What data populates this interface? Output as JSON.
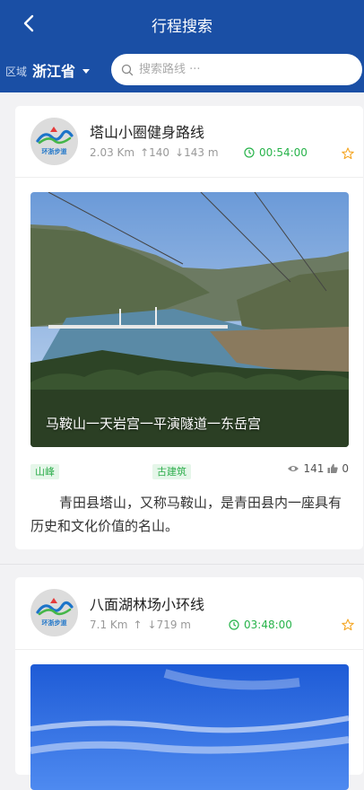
{
  "header": {
    "title": "行程搜索",
    "region_label": "区域",
    "region_value": "浙江省",
    "search_placeholder": "搜索路线 ···"
  },
  "colors": {
    "header_bg": "#1a4fa5",
    "time_green": "#27b34a",
    "tag_green": "#2eae4d",
    "star_orange": "#f5a623"
  },
  "routes": [
    {
      "name": "塔山小圈健身路线",
      "distance": "2.03 Km",
      "ascent": "↑140",
      "descent": "↓143 m",
      "duration": "00:54:00",
      "photo_caption": "马鞍山一天岩宫一平演隧道一东岳宫",
      "tags": [
        "山峰",
        "古建筑"
      ],
      "views": "141",
      "likes": "0",
      "description": "青田县塔山，又称马鞍山，是青田县内一座具有历史和文化价值的名山。",
      "logo_text": "环浙步道"
    },
    {
      "name": "八面湖林场小环线",
      "distance": "7.1 Km",
      "ascent": "↑",
      "descent": "↓719 m",
      "duration": "03:48:00",
      "logo_text": "环浙步道"
    }
  ]
}
